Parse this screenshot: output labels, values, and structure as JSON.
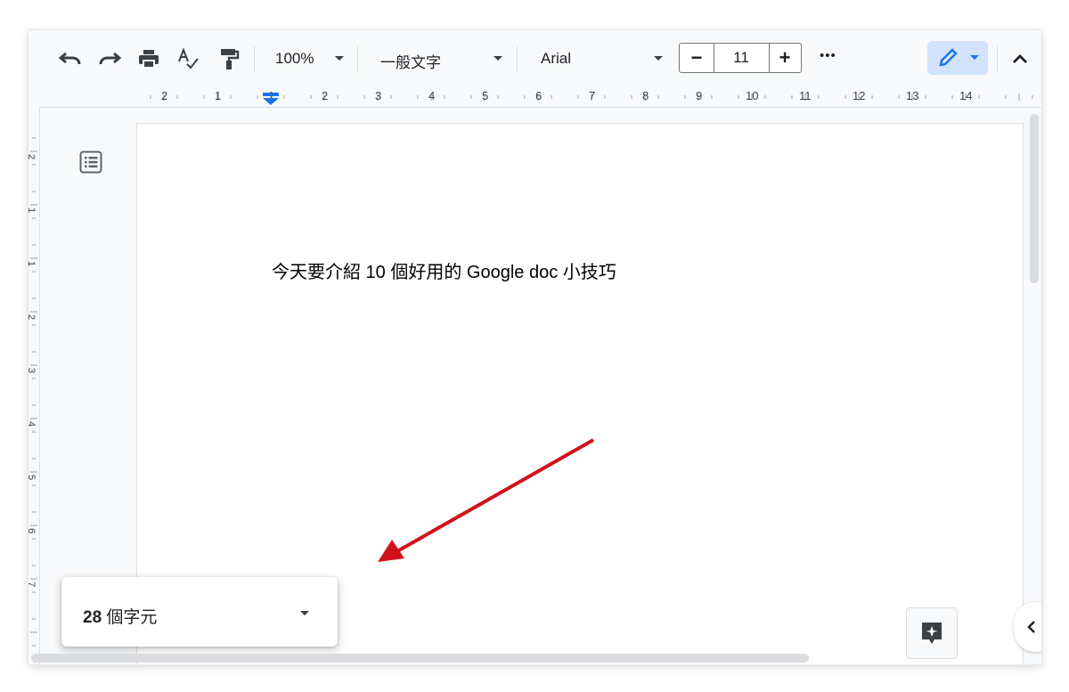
{
  "toolbar": {
    "zoom": "100%",
    "style": "一般文字",
    "font": "Arial",
    "font_size": "11",
    "minus_label": "−",
    "plus_label": "+",
    "more_label": "•••"
  },
  "ruler": {
    "horizontal_numbers": [
      "2",
      "1",
      "1",
      "2",
      "3",
      "4",
      "5",
      "6",
      "7",
      "8",
      "9",
      "10",
      "11",
      "12",
      "13",
      "14"
    ],
    "vertical_numbers": [
      "2",
      "1",
      "1",
      "2",
      "3",
      "4",
      "5",
      "6",
      "7"
    ]
  },
  "document": {
    "text": "今天要介紹 10 個好用的 Google doc 小技巧"
  },
  "word_count": {
    "count": "28",
    "unit": " 個字元"
  },
  "colors": {
    "accent_blue": "#1a73e8",
    "arrow_red": "#d0121b",
    "edit_mode_bg": "#d3e3fd"
  },
  "icons": [
    "undo-icon",
    "redo-icon",
    "print-icon",
    "spellcheck-icon",
    "paint-format-icon",
    "pencil-icon",
    "chevron-up-icon",
    "outline-icon",
    "explore-icon",
    "chevron-left-icon"
  ]
}
